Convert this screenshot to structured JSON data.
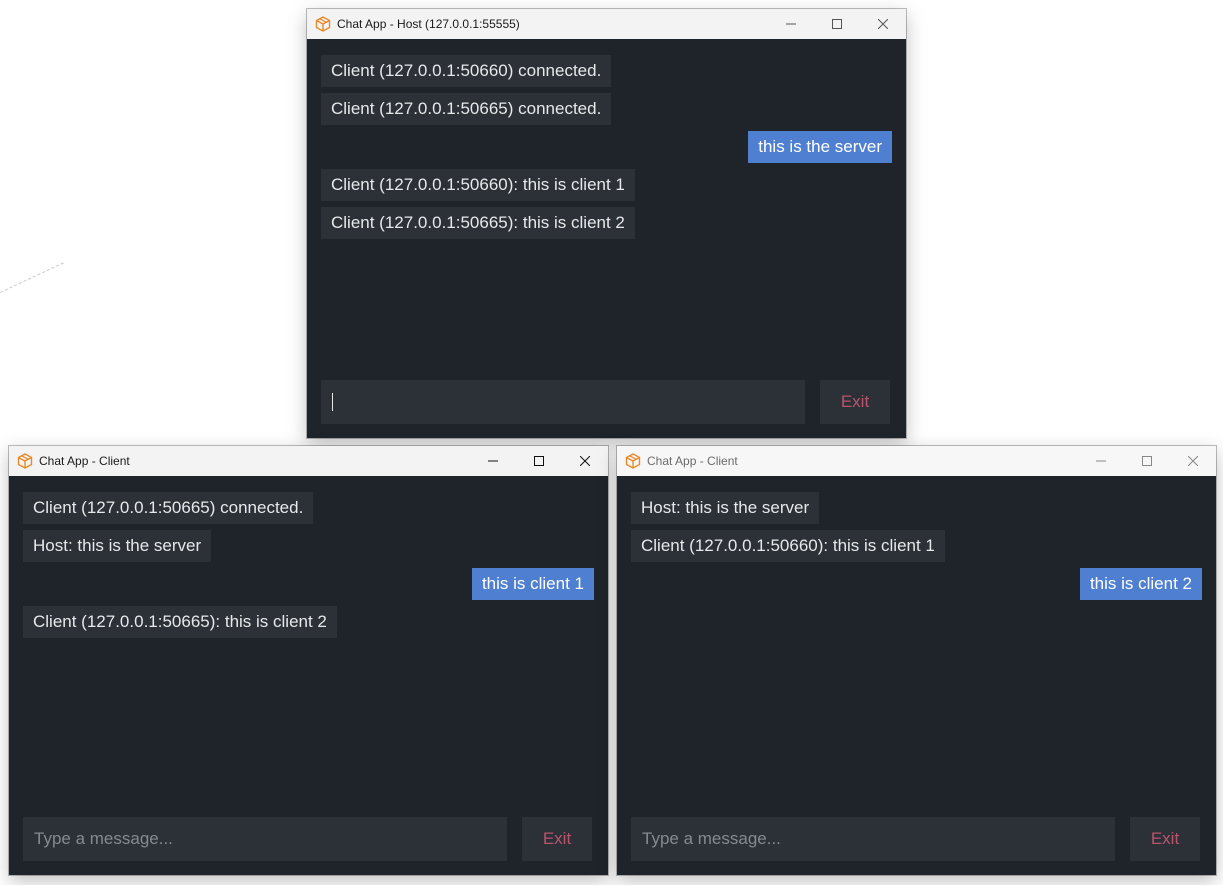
{
  "windows": {
    "host": {
      "title": "Chat App - Host (127.0.0.1:55555)",
      "messages": [
        {
          "text": "Client (127.0.0.1:50660) connected.",
          "own": false
        },
        {
          "text": "Client (127.0.0.1:50665) connected.",
          "own": false
        },
        {
          "text": "this is the server",
          "own": true
        },
        {
          "text": "Client (127.0.0.1:50660): this is client 1",
          "own": false
        },
        {
          "text": "Client (127.0.0.1:50665): this is client 2",
          "own": false
        }
      ],
      "input_value": "",
      "input_placeholder": "",
      "exit_label": "Exit"
    },
    "client1": {
      "title": "Chat App - Client",
      "messages": [
        {
          "text": "Client (127.0.0.1:50665) connected.",
          "own": false
        },
        {
          "text": "Host: this is the server",
          "own": false
        },
        {
          "text": "this is client 1",
          "own": true
        },
        {
          "text": "Client (127.0.0.1:50665): this is client 2",
          "own": false
        }
      ],
      "input_value": "",
      "input_placeholder": "Type a message...",
      "exit_label": "Exit"
    },
    "client2": {
      "title": "Chat App - Client",
      "messages": [
        {
          "text": "Host: this is the server",
          "own": false
        },
        {
          "text": "Client (127.0.0.1:50660): this is client 1",
          "own": false
        },
        {
          "text": "this is client 2",
          "own": true
        }
      ],
      "input_value": "",
      "input_placeholder": "Type a message...",
      "exit_label": "Exit"
    }
  },
  "icons": {
    "app": "package-box-icon",
    "minimize": "minimize-icon",
    "maximize": "maximize-icon",
    "close": "close-icon"
  },
  "colors": {
    "window_bg": "#1f232a",
    "bubble_bg": "#2c3138",
    "own_bubble_bg": "#4f7fd0",
    "exit_text": "#b9546c",
    "app_icon": "#e8892b"
  }
}
